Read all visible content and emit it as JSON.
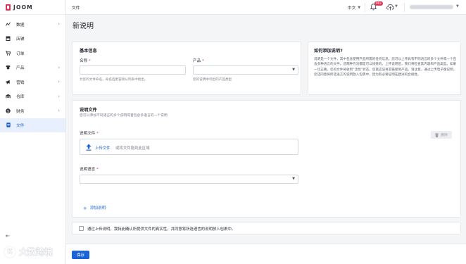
{
  "app": {
    "logo_text": "JOOM",
    "brand_color": "#e0355b",
    "accent_color": "#1b64d8"
  },
  "sidebar": {
    "items": [
      {
        "label": "数据",
        "icon": "chart-line-icon",
        "has_children": true
      },
      {
        "label": "店铺",
        "icon": "store-icon",
        "has_children": false
      },
      {
        "label": "订单",
        "icon": "cart-icon",
        "has_children": false
      },
      {
        "label": "产品",
        "icon": "shirt-icon",
        "has_children": true
      },
      {
        "label": "营销",
        "icon": "megaphone-icon",
        "has_children": true
      },
      {
        "label": "仓库",
        "icon": "warehouse-icon",
        "has_children": true
      },
      {
        "label": "财务",
        "icon": "dollar-icon",
        "has_children": true
      },
      {
        "label": "文件",
        "icon": "document-icon",
        "has_children": false,
        "active": true
      }
    ],
    "collapse_icon": "collapse-sidebar-icon"
  },
  "topbar": {
    "breadcrumb": "文件",
    "language": "中文",
    "notification_badge": "99+"
  },
  "page": {
    "title": "新说明"
  },
  "basic_info": {
    "title": "基本信息",
    "name_label": "名称",
    "name_value": "",
    "name_hint": "为您的文件命名。命名后更容易从列表中找出。",
    "product_label": "产品",
    "product_value": "",
    "product_hint": "您的说明中列出的产品类型"
  },
  "help": {
    "title": "如何添加说明?",
    "text": "说明是一个文件，其中包含使用产品所需的任何信息。您可以上传具有不同语言的多个文件或一个包含多种语言的文件。这两种方法都是可以接受的。上传说明后，我们将检查其内容和产品类型。如果一切正确，您的文件将收到“活性”状态。您就应该将其链接到产品。请注意，通过上传电子版说明，您还同意将所选语言的说明放入包裹中，因为有必要证明在欧洲的合规性。"
  },
  "files": {
    "title": "说明文件",
    "subtitle": "您可以添加不同语言的多个说明或者包含多语言的一个说明",
    "file_label": "说明文件",
    "upload_link": "上传文件",
    "upload_hint": "或将文件拖到此区域",
    "delete_label": "删除",
    "language_label": "说明语言",
    "language_value": "",
    "add_label": "添加说明"
  },
  "agreement": {
    "checked": false,
    "text": "通过上传说明，我特此确认所提供文件的真实性，并同意将所选语言的说明放入包裹中。"
  },
  "footer": {
    "save_label": "保存"
  },
  "watermark": {
    "text": "大数跨境"
  }
}
